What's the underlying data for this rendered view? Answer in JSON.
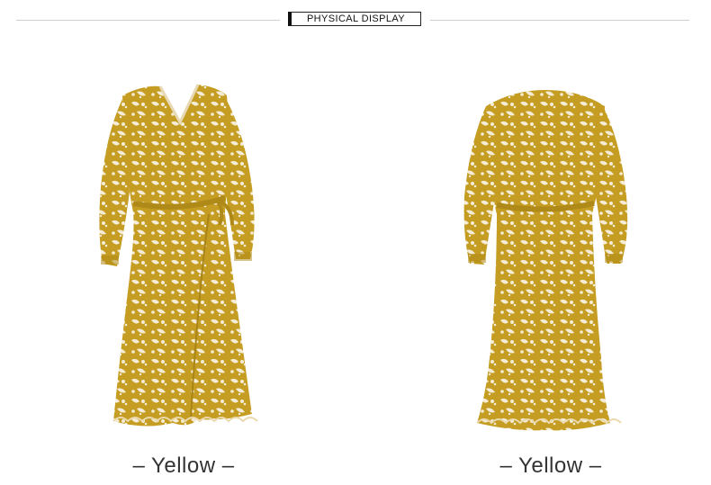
{
  "header": {
    "title": "PHYSICAL DISPLAY"
  },
  "products": [
    {
      "caption": "– Yellow –",
      "view": "front",
      "color": "#c59d22"
    },
    {
      "caption": "– Yellow –",
      "view": "back",
      "color": "#c59d22"
    }
  ],
  "colors": {
    "dress_base": "#c59d22",
    "pattern": "#f4ecd6",
    "rule": "#cfcfcf",
    "text": "#333333"
  }
}
